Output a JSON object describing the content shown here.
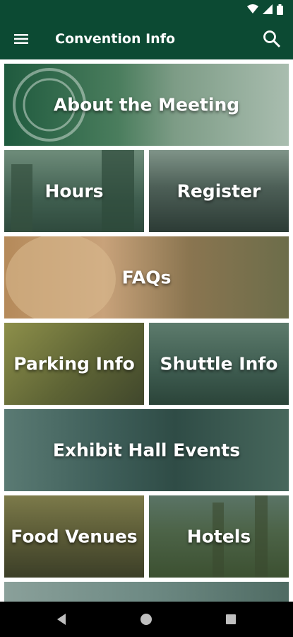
{
  "colors": {
    "app_bar": "#0c4a33",
    "nav_bar": "#000000",
    "tile_text": "#ffffff"
  },
  "status_bar": {
    "icons": [
      "wifi-icon",
      "signal-icon",
      "battery-icon"
    ]
  },
  "app_bar": {
    "title": "Convention Info",
    "menu_icon": "menu-icon",
    "search_icon": "search-icon"
  },
  "tiles": [
    {
      "id": "about",
      "label": "About the Meeting"
    },
    {
      "id": "hours",
      "label": "Hours"
    },
    {
      "id": "register",
      "label": "Register"
    },
    {
      "id": "faqs",
      "label": "FAQs"
    },
    {
      "id": "parking",
      "label": "Parking Info"
    },
    {
      "id": "shuttle",
      "label": "Shuttle Info"
    },
    {
      "id": "exhibit",
      "label": "Exhibit Hall Events"
    },
    {
      "id": "food",
      "label": "Food Venues"
    },
    {
      "id": "hotels",
      "label": "Hotels"
    }
  ],
  "nav_bar": {
    "buttons": [
      "back-icon",
      "home-icon",
      "recents-icon"
    ]
  }
}
